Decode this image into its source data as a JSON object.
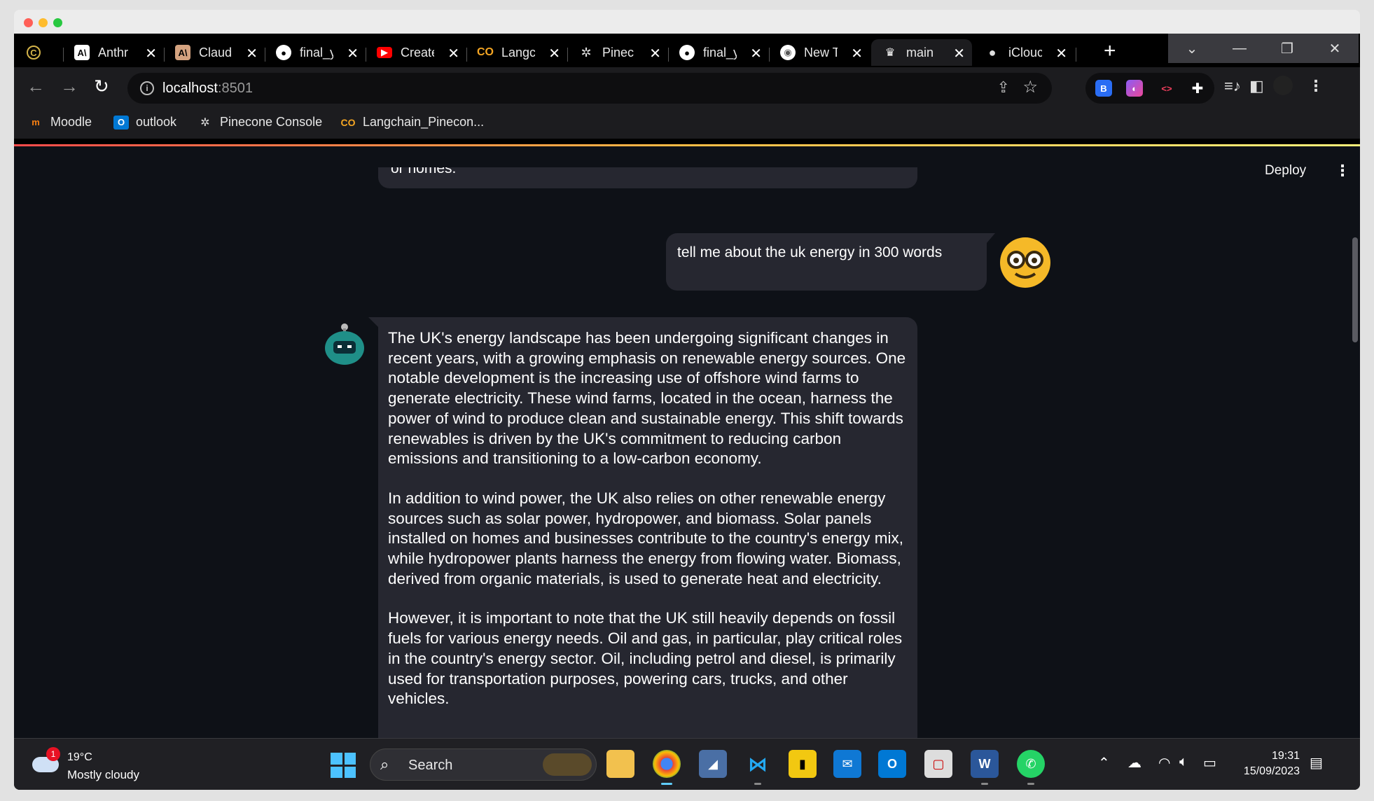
{
  "browser": {
    "tabs": [
      {
        "label": "",
        "icon": "coin-c-icon"
      },
      {
        "label": "Anthr",
        "icon": "anthropic-icon"
      },
      {
        "label": "Claud",
        "icon": "anthropic-icon"
      },
      {
        "label": "final_y",
        "icon": "github-icon"
      },
      {
        "label": "Create",
        "icon": "youtube-icon"
      },
      {
        "label": "Langc",
        "icon": "langchain-icon"
      },
      {
        "label": "Pinec",
        "icon": "pinecone-icon"
      },
      {
        "label": "final_y",
        "icon": "github-icon"
      },
      {
        "label": "New T",
        "icon": "chrome-icon"
      },
      {
        "label": "main",
        "icon": "streamlit-icon",
        "active": true
      },
      {
        "label": "iClouc",
        "icon": "apple-icon"
      }
    ],
    "address": {
      "host": "localhost",
      "port": ":8501"
    },
    "bookmarks": [
      {
        "label": "Moodle",
        "icon": "moodle-icon"
      },
      {
        "label": "outlook",
        "icon": "outlook-icon"
      },
      {
        "label": "Pinecone Console",
        "icon": "pinecone-icon"
      },
      {
        "label": "Langchain_Pinecon...",
        "icon": "langchain-icon"
      }
    ]
  },
  "app": {
    "deploy_label": "Deploy",
    "prev_message_fragment": "or homes.",
    "user_message": "tell me about the uk energy in 300 words",
    "assistant_paragraphs": [
      "The UK's energy landscape has been undergoing significant changes in recent years, with a growing emphasis on renewable energy sources. One notable development is the increasing use of offshore wind farms to generate electricity. These wind farms, located in the ocean, harness the power of wind to produce clean and sustainable energy. This shift towards renewables is driven by the UK's commitment to reducing carbon emissions and transitioning to a low-carbon economy.",
      "In addition to wind power, the UK also relies on other renewable energy sources such as solar power, hydropower, and biomass. Solar panels installed on homes and businesses contribute to the country's energy mix, while hydropower plants harness the energy from flowing water. Biomass, derived from organic materials, is used to generate heat and electricity.",
      "However, it is important to note that the UK still heavily depends on fossil fuels for various energy needs. Oil and gas, in particular, play critical roles in the country's energy sector. Oil, including petrol and diesel, is primarily used for transportation purposes, powering cars, trucks, and other vehicles."
    ]
  },
  "taskbar": {
    "weather_temp": "19°C",
    "weather_desc": "Mostly cloudy",
    "weather_badge": "1",
    "search_label": "Search",
    "time": "19:31",
    "date": "15/09/2023"
  },
  "colors": {
    "app_bg": "#0e1117",
    "bubble_bg": "#262730",
    "accent_red": "#ff4b4b"
  }
}
